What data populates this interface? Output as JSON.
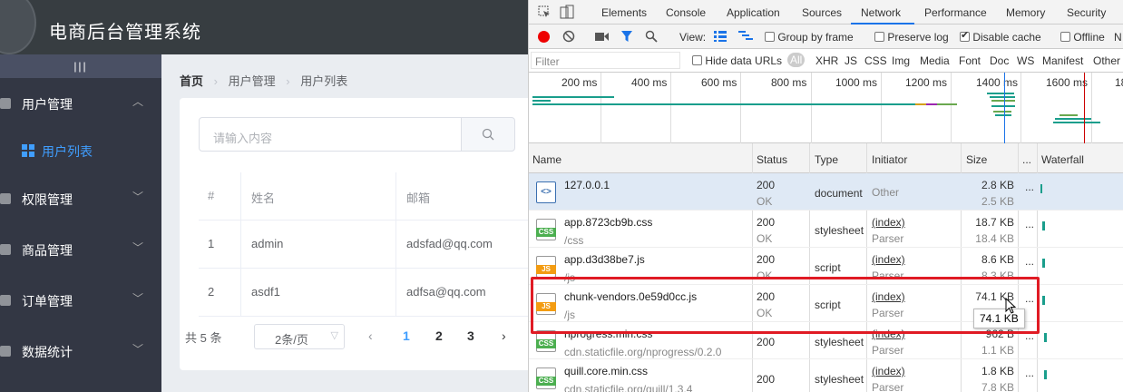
{
  "app": {
    "title": "电商后台管理系统",
    "toggle": "|||",
    "menus": [
      {
        "label": "用户管理",
        "chev": "︿"
      },
      {
        "label": "权限管理",
        "chev": "﹀"
      },
      {
        "label": "商品管理",
        "chev": "﹀"
      },
      {
        "label": "订单管理",
        "chev": "﹀"
      },
      {
        "label": "数据统计",
        "chev": "﹀"
      }
    ],
    "submenu_active": "用户列表",
    "accent": "#409eff"
  },
  "breadcrumb": {
    "home": "首页",
    "sep": "›",
    "level1": "用户管理",
    "level2": "用户列表"
  },
  "search": {
    "placeholder": "请输入内容"
  },
  "table": {
    "headers": [
      "#",
      "姓名",
      "邮箱"
    ],
    "rows": [
      [
        "1",
        "admin",
        "adsfad@qq.com"
      ],
      [
        "2",
        "asdf1",
        "adfsa@qq.com"
      ]
    ]
  },
  "pager": {
    "total": "共 5 条",
    "size": "2条/页",
    "prev": "‹",
    "next": "›",
    "pages": [
      "1",
      "2",
      "3"
    ],
    "current": "1"
  },
  "devtools": {
    "tabs": [
      "Elements",
      "Console",
      "Application",
      "Sources",
      "Network",
      "Performance",
      "Memory",
      "Security"
    ],
    "active_tab": "Network",
    "toolbar": {
      "view": "View:",
      "group_by_frame": "Group by frame",
      "preserve_log": "Preserve log",
      "disable_cache": "Disable cache",
      "offline": "Offline",
      "more": "N"
    },
    "filter": {
      "placeholder": "Filter",
      "hide_data_urls": "Hide data URLs",
      "types": [
        "All",
        "XHR",
        "JS",
        "CSS",
        "Img",
        "Media",
        "Font",
        "Doc",
        "WS",
        "Manifest",
        "Other"
      ]
    },
    "overview_ticks": [
      "200 ms",
      "400 ms",
      "600 ms",
      "800 ms",
      "1000 ms",
      "1200 ms",
      "1400 ms",
      "1600 ms",
      "18"
    ],
    "columns": [
      "Name",
      "Status",
      "Type",
      "Initiator",
      "Size",
      "...",
      "Waterfall"
    ],
    "requests": [
      {
        "name": "127.0.0.1",
        "path": "",
        "status": "200",
        "status_text": "OK",
        "type": "document",
        "initiator": "Other",
        "initiator_sub": "",
        "size": "2.8 KB",
        "size_sub": "2.5 KB",
        "icon": "html",
        "icon_label": "<>"
      },
      {
        "name": "app.8723cb9b.css",
        "path": "/css",
        "status": "200",
        "status_text": "OK",
        "type": "stylesheet",
        "initiator": "(index)",
        "initiator_sub": "Parser",
        "size": "18.7 KB",
        "size_sub": "18.4 KB",
        "icon": "css",
        "icon_label": "CSS"
      },
      {
        "name": "app.d3d38be7.js",
        "path": "/js",
        "status": "200",
        "status_text": "OK",
        "type": "script",
        "initiator": "(index)",
        "initiator_sub": "Parser",
        "size": "8.6 KB",
        "size_sub": "8.3 KB",
        "icon": "js",
        "icon_label": "JS"
      },
      {
        "name": "chunk-vendors.0e59d0cc.js",
        "path": "/js",
        "status": "200",
        "status_text": "OK",
        "type": "script",
        "initiator": "(index)",
        "initiator_sub": "Parser",
        "size": "74.1 KB",
        "size_sub": "",
        "icon": "js",
        "icon_label": "JS"
      },
      {
        "name": "nprogress.min.css",
        "path": "cdn.staticfile.org/nprogress/0.2.0",
        "status": "200",
        "status_text": "",
        "type": "stylesheet",
        "initiator": "(index)",
        "initiator_sub": "Parser",
        "size": "962 B",
        "size_sub": "1.1 KB",
        "icon": "css",
        "icon_label": "CSS"
      },
      {
        "name": "quill.core.min.css",
        "path": "cdn.staticfile.org/quill/1.3.4",
        "status": "200",
        "status_text": "",
        "type": "stylesheet",
        "initiator": "(index)",
        "initiator_sub": "Parser",
        "size": "1.8 KB",
        "size_sub": "7.8 KB",
        "icon": "css",
        "icon_label": "CSS"
      }
    ],
    "tooltip": "74.1 KB",
    "more": "..."
  }
}
